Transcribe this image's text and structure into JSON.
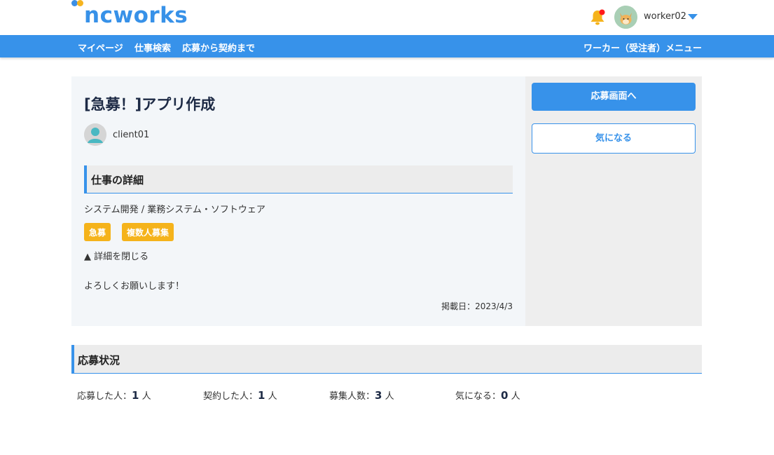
{
  "header": {
    "logo_text": "ncworks",
    "username": "worker02"
  },
  "nav": {
    "items": [
      "マイページ",
      "仕事検索",
      "応募から契約まで"
    ],
    "menu": "ワーカー（受注者）メニュー"
  },
  "job": {
    "title": "[急募！]アプリ作成",
    "client": "client01",
    "section_title": "仕事の詳細",
    "category": "システム開発 / 業務システム・ソフトウェア",
    "badges": [
      "急募",
      "複数人募集"
    ],
    "toggle_detail": "▲ 詳細を閉じる",
    "description": "よろしくお願いします！",
    "posted": "掲載日：2023/4/3"
  },
  "actions": {
    "apply": "応募画面へ",
    "favorite": "気になる"
  },
  "status": {
    "title": "応募状況",
    "applied_label": "応募した人：",
    "applied_value": "1",
    "contracted_label": "契約した人：",
    "contracted_value": "1",
    "recruit_label": "募集人数：",
    "recruit_value": "3",
    "favorite_label": "気になる：",
    "favorite_value": "0",
    "unit": "人"
  },
  "colors": {
    "primary": "#3792ea",
    "badge": "#f5b31b",
    "notification": "#ff1a1a"
  }
}
